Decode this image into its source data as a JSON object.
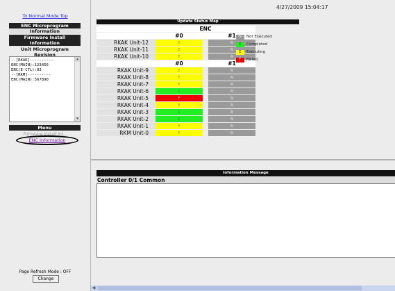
{
  "left": {
    "normal_link": "To Normal Mode Top",
    "enc_info_title": [
      "ENC Microprogram",
      "Information"
    ],
    "firmware_title": [
      "Firmware Install",
      "Information"
    ],
    "unit_rev_title": [
      "Unit Microprogram",
      "Revision"
    ],
    "revision_lines": [
      "--[RKAK]----------",
      "ENC(MAIN):123456",
      "ENC(E-CTL):03",
      "--[RKM]----------",
      "ENC(MAIN):567890"
    ],
    "menu_label": "Menu",
    "menu_hidden_item": "Firmware Install Inf...",
    "enc_info_link": "ENC Information",
    "refresh_mode": "Page Refresh Mode : OFF",
    "change_button": "Change"
  },
  "header": {
    "timestamp": "4/27/2009 15:04:17"
  },
  "status_map": {
    "title": "Update Status Map",
    "group_header": "ENC",
    "col0": "#0",
    "col1": "#1",
    "colors": {
      "E": "#ffff00",
      "N": "#9a9a9a",
      "C": "#22ee22",
      "F": "#ee0000"
    },
    "rows_top": [
      {
        "unit": "RKAK Unit-12",
        "c0": "E",
        "c1": "N"
      },
      {
        "unit": "RKAK Unit-11",
        "c0": "E",
        "c1": "N"
      },
      {
        "unit": "RKAK Unit-10",
        "c0": "E",
        "c1": "N"
      }
    ],
    "rows_bottom": [
      {
        "unit": "RKAK Unit-9",
        "c0": "E",
        "c1": "N"
      },
      {
        "unit": "RKAK Unit-8",
        "c0": "E",
        "c1": "N"
      },
      {
        "unit": "RKAK Unit-7",
        "c0": "E",
        "c1": "N"
      },
      {
        "unit": "RKAK Unit-6",
        "c0": "C",
        "c1": "N"
      },
      {
        "unit": "RKAK Unit-5",
        "c0": "F",
        "c1": "N"
      },
      {
        "unit": "RKAK Unit-4",
        "c0": "E",
        "c1": "N"
      },
      {
        "unit": "RKAK Unit-3",
        "c0": "C",
        "c1": "N"
      },
      {
        "unit": "RKAK Unit-2",
        "c0": "C",
        "c1": "N"
      },
      {
        "unit": "RKAK Unit-1",
        "c0": "E",
        "c1": "N"
      },
      {
        "unit": "RKM Unit-0",
        "c0": "E",
        "c1": "N"
      }
    ],
    "legend": [
      {
        "code": "N",
        "label": "Not Executed"
      },
      {
        "code": "C",
        "label": "Completed"
      },
      {
        "code": "E",
        "label": "Executing"
      },
      {
        "code": "F",
        "label": "Failed"
      }
    ]
  },
  "info": {
    "title": "Information Message",
    "row_label": "Controller 0/1 Common"
  }
}
